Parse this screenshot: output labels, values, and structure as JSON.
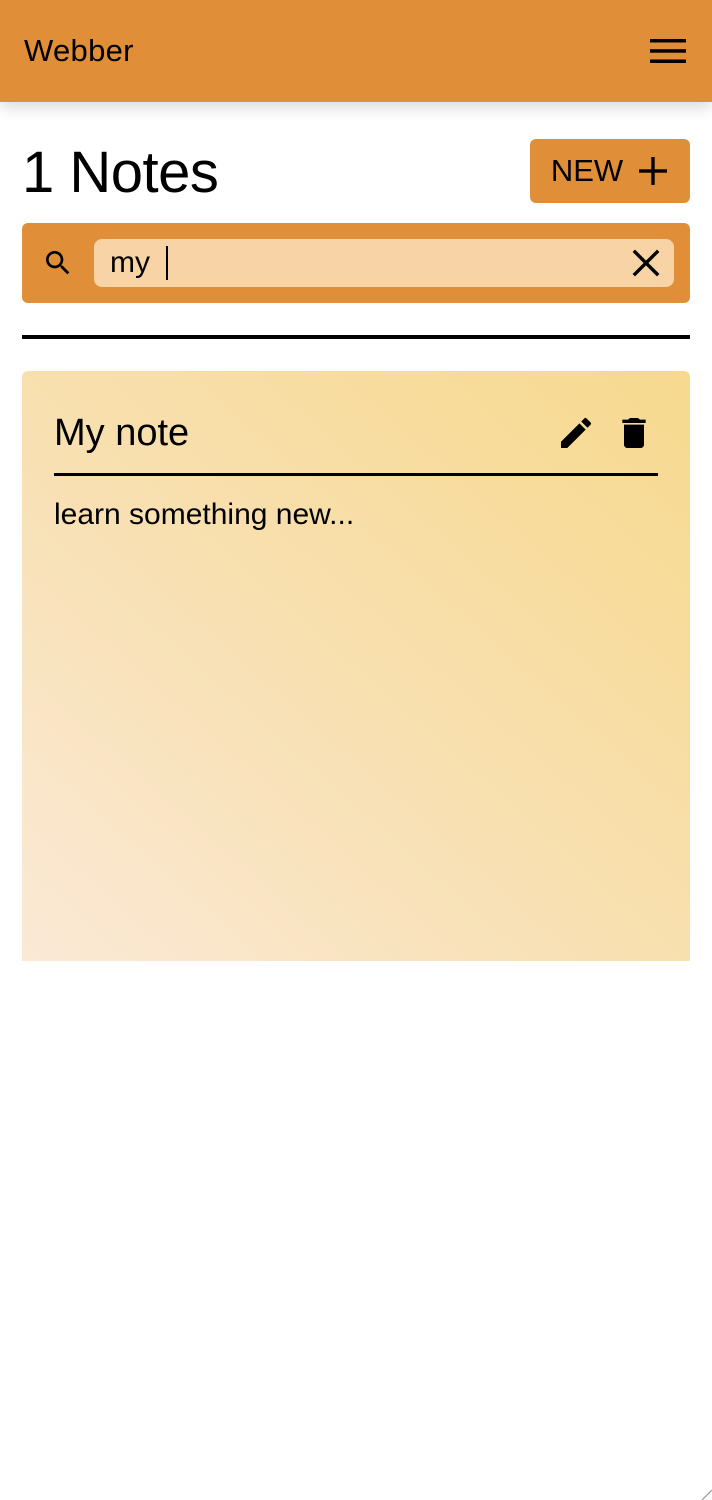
{
  "app": {
    "title": "Webber",
    "accent_color": "#e08e38",
    "menu_icon": "hamburger-menu-icon"
  },
  "header": {
    "count_label": "1 Notes",
    "new_button_label": "NEW",
    "new_button_icon": "plus-icon"
  },
  "search": {
    "icon": "search-icon",
    "value": "my ",
    "clear_icon": "close-icon"
  },
  "notes": [
    {
      "title": "My note",
      "body": "learn something new...",
      "actions": [
        "pencil-icon",
        "trash-icon"
      ]
    }
  ]
}
